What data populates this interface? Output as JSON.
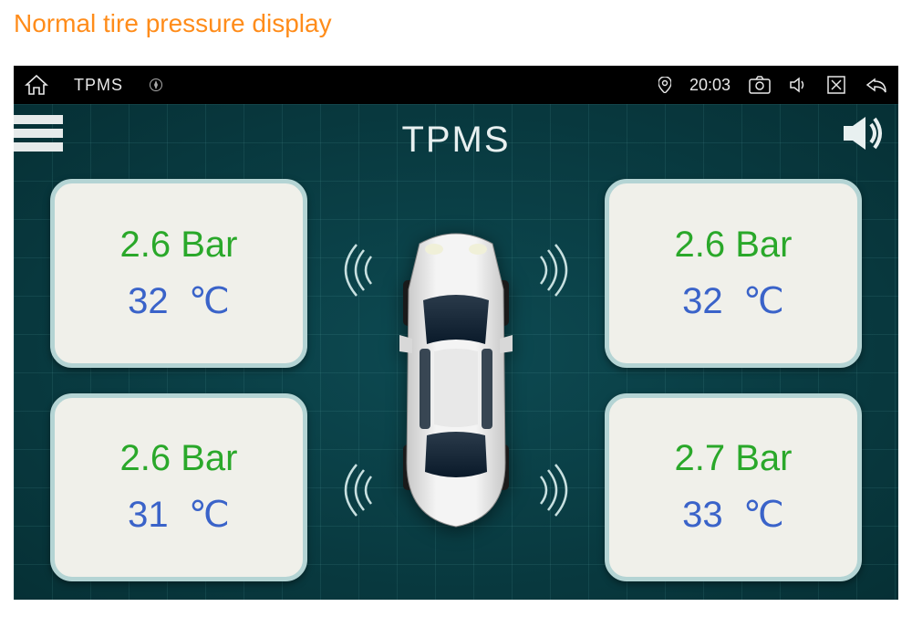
{
  "caption": "Normal tire pressure display",
  "statusbar": {
    "app_name": "TPMS",
    "time": "20:03"
  },
  "app": {
    "title": "TPMS",
    "pressure_unit": "Bar",
    "temperature_unit": "℃",
    "tires": {
      "front_left": {
        "pressure": "2.6",
        "temperature": "32"
      },
      "front_right": {
        "pressure": "2.6",
        "temperature": "32"
      },
      "rear_left": {
        "pressure": "2.6",
        "temperature": "31"
      },
      "rear_right": {
        "pressure": "2.7",
        "temperature": "33"
      }
    }
  }
}
